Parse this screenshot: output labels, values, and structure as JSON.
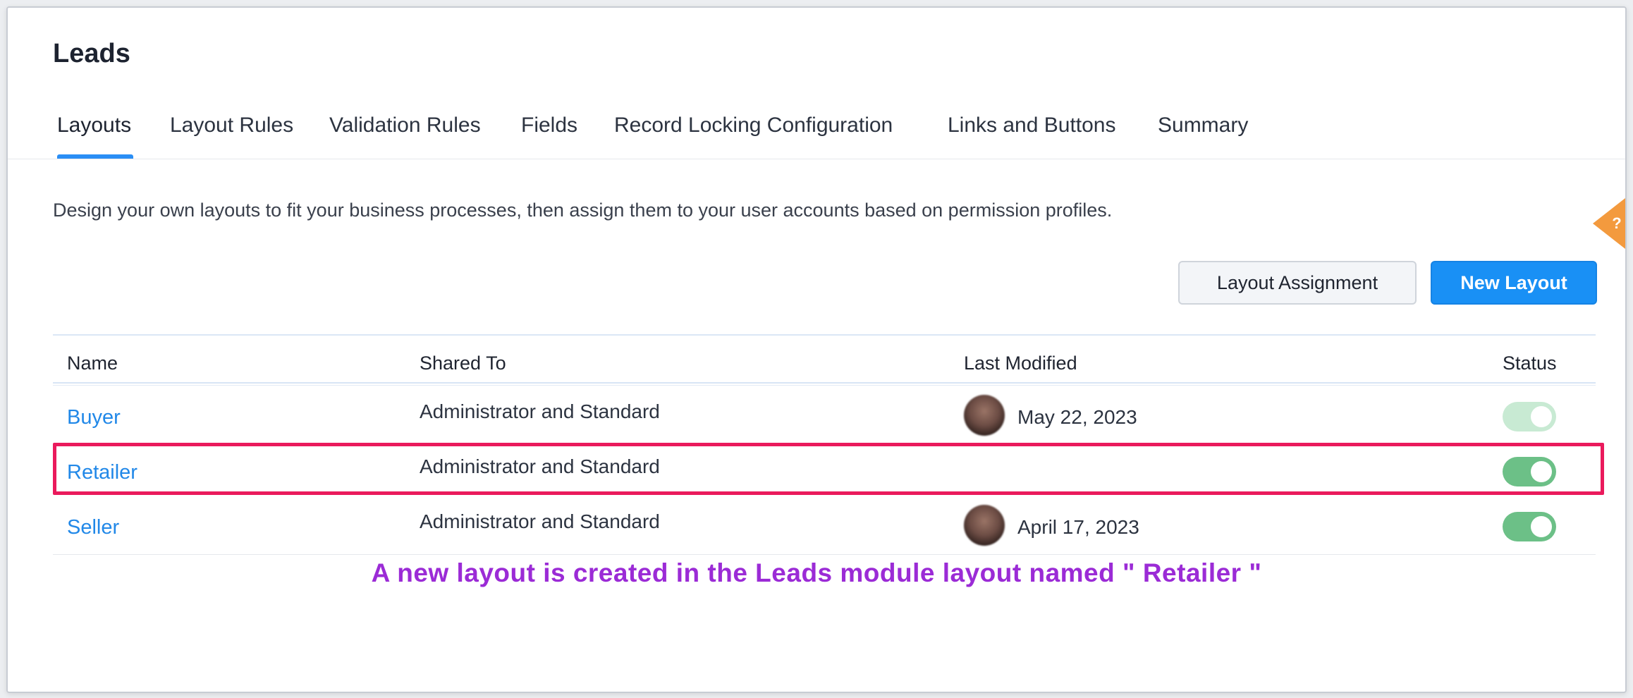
{
  "page": {
    "title": "Leads",
    "description": "Design your own layouts to fit your business processes, then assign them to your user accounts based on permission profiles."
  },
  "tabs": [
    {
      "label": "Layouts",
      "active": true
    },
    {
      "label": "Layout Rules",
      "active": false
    },
    {
      "label": "Validation Rules",
      "active": false
    },
    {
      "label": "Fields",
      "active": false
    },
    {
      "label": "Record Locking Configuration",
      "active": false
    },
    {
      "label": "Links and Buttons",
      "active": false
    },
    {
      "label": "Summary",
      "active": false
    }
  ],
  "actions": {
    "layout_assignment_label": "Layout Assignment",
    "new_layout_label": "New Layout"
  },
  "table": {
    "columns": [
      "Name",
      "Shared To",
      "Last Modified",
      "Status"
    ],
    "rows": [
      {
        "name": "Buyer",
        "shared_to": "Administrator and Standard",
        "last_modified": "May 22, 2023",
        "has_avatar": true,
        "status": "on-faded"
      },
      {
        "name": "Retailer",
        "shared_to": "Administrator and Standard",
        "last_modified": "",
        "has_avatar": false,
        "status": "on"
      },
      {
        "name": "Seller",
        "shared_to": "Administrator and Standard",
        "last_modified": "April 17, 2023",
        "has_avatar": true,
        "status": "on"
      }
    ]
  },
  "annotation": {
    "caption": "A new layout is created in the Leads module layout named \" Retailer \"",
    "highlight_color": "#ea1a5c",
    "caption_color": "#9b2bd6"
  },
  "help": {
    "icon": "question-icon",
    "glyph": "?"
  },
  "colors": {
    "primary": "#1990f5",
    "link": "#2188e8",
    "toggle_on": "#6cc087",
    "help_tab": "#f39a3e"
  }
}
